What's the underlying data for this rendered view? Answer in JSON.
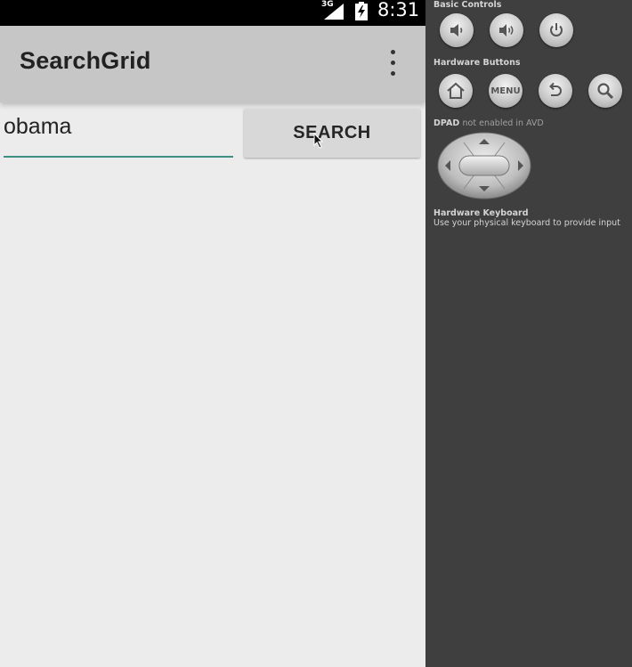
{
  "status_bar": {
    "network": "3G",
    "time": "8:31",
    "icons": [
      "signal-icon",
      "battery-charging-icon"
    ]
  },
  "app_bar": {
    "title": "SearchGrid",
    "menu_icon": "overflow-menu-icon"
  },
  "search": {
    "value": "obama",
    "placeholder": "",
    "button_label": "SEARCH"
  },
  "colors": {
    "app_bar": "#c6c6c6",
    "background": "#ececec",
    "input_underline": "#3f8f85",
    "button": "#d8d8d8",
    "panel": "#3f3f3f"
  },
  "panel": {
    "basic_controls": {
      "label": "Basic Controls",
      "buttons": [
        "volume-down-icon",
        "volume-up-icon",
        "power-icon"
      ]
    },
    "hardware_buttons": {
      "label": "Hardware Buttons",
      "menu_label": "MENU",
      "buttons": [
        "home-icon",
        "menu-button",
        "back-icon",
        "search-icon"
      ]
    },
    "dpad": {
      "label": "DPAD",
      "status": "not enabled in AVD"
    },
    "keyboard": {
      "label": "Hardware Keyboard",
      "hint": "Use your physical keyboard to provide input"
    }
  }
}
